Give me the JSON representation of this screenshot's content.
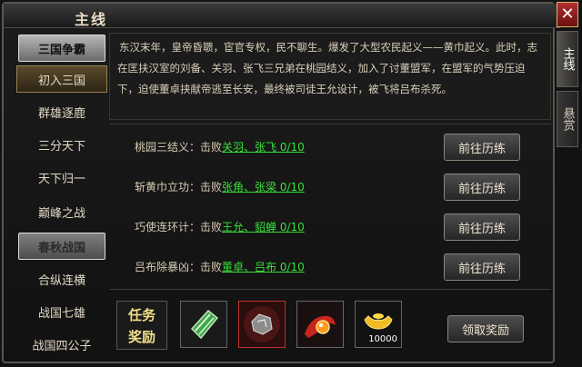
{
  "window": {
    "title": "主线",
    "close_label": "✕"
  },
  "side_tabs": [
    {
      "label": "主线"
    },
    {
      "label": "悬赏"
    }
  ],
  "sidebar": {
    "items": [
      {
        "label": "三国争霸",
        "kind": "category"
      },
      {
        "label": "初入三国",
        "kind": "selected"
      },
      {
        "label": "群雄逐鹿",
        "kind": "item"
      },
      {
        "label": "三分天下",
        "kind": "item"
      },
      {
        "label": "天下归一",
        "kind": "item"
      },
      {
        "label": "巅峰之战",
        "kind": "item"
      },
      {
        "label": "春秋战国",
        "kind": "category-dim"
      },
      {
        "label": "合纵连横",
        "kind": "item"
      },
      {
        "label": "战国七雄",
        "kind": "item"
      },
      {
        "label": "战国四公子",
        "kind": "item"
      }
    ]
  },
  "story": {
    "text": "东汉末年，皇帝昏聩，宦官专权，民不聊生。爆发了大型农民起义——黄巾起义。此时，志在匡扶汉室的刘备、关羽、张飞三兄弟在桃园结义，加入了讨董盟军，在盟军的气势压迫下，迫使董卓挟献帝逃至长安，最终被司徒王允设计，被飞将吕布杀死。"
  },
  "quests": [
    {
      "name": "桃园三结义：击败",
      "targets": "关羽、张飞 0/10",
      "button": "前往历练"
    },
    {
      "name": "斩黄巾立功：击败",
      "targets": "张角、张梁 0/10",
      "button": "前往历练"
    },
    {
      "name": "巧使连环计：击败",
      "targets": "王允、貂蝉 0/10",
      "button": "前往历练"
    },
    {
      "name": "吕布除暴凶：击败",
      "targets": "董卓、吕布 0/10",
      "button": "前往历练"
    }
  ],
  "rewards": {
    "badge_line1": "任务",
    "badge_line2": "奖励",
    "items": [
      {
        "icon": "scroll-icon",
        "count": ""
      },
      {
        "icon": "ore-icon",
        "count": ""
      },
      {
        "icon": "dragon-orb-icon",
        "count": ""
      },
      {
        "icon": "gold-ingot-icon",
        "count": "10000"
      }
    ],
    "claim_label": "领取奖励"
  }
}
